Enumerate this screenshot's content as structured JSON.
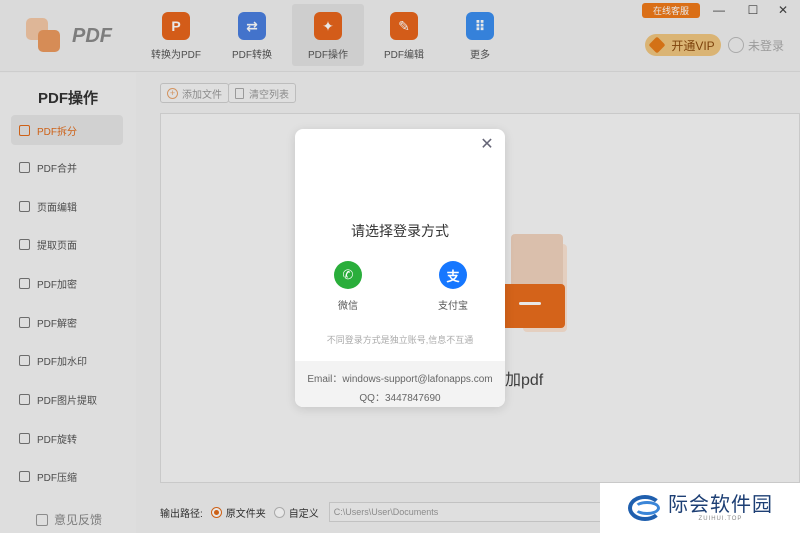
{
  "app": {
    "logo_text": "PDF"
  },
  "toolbar": {
    "tools": [
      {
        "label": "转换为PDF",
        "color": "#e8661c",
        "glyph": "P"
      },
      {
        "label": "PDF转换",
        "color": "#4a7fe0",
        "glyph": "⇄"
      },
      {
        "label": "PDF操作",
        "color": "#e8661c",
        "glyph": "✦"
      },
      {
        "label": "PDF编辑",
        "color": "#e8661c",
        "glyph": "✎"
      },
      {
        "label": "更多",
        "color": "#3b8ef0",
        "glyph": "⠿"
      }
    ],
    "active_index": 2
  },
  "titlebar": {
    "service_label": "在线客服",
    "min_glyph": "—",
    "max_glyph": "☐",
    "close_glyph": "✕"
  },
  "account": {
    "vip_label": "开通VIP",
    "login_label": "未登录"
  },
  "sidebar": {
    "title": "PDF操作",
    "items": [
      {
        "label": "PDF拆分"
      },
      {
        "label": "PDF合并"
      },
      {
        "label": "页面编辑"
      },
      {
        "label": "提取页面"
      },
      {
        "label": "PDF加密"
      },
      {
        "label": "PDF解密"
      },
      {
        "label": "PDF加水印"
      },
      {
        "label": "PDF图片提取"
      },
      {
        "label": "PDF旋转"
      },
      {
        "label": "PDF压缩"
      }
    ],
    "active_index": 0,
    "feedback_label": "意见反馈"
  },
  "main": {
    "add_file_label": "添加文件",
    "clear_list_label": "清空列表",
    "drop_text": "加pdf",
    "output": {
      "label": "输出路径:",
      "option_source": "原文件夹",
      "option_custom": "自定义",
      "selected": "原文件夹",
      "path_value": "C:\\Users\\User\\Documents"
    }
  },
  "modal": {
    "close_glyph": "✕",
    "title": "请选择登录方式",
    "options": [
      {
        "label": "微信",
        "color": "#2aae3b",
        "glyph": "✆"
      },
      {
        "label": "支付宝",
        "color": "#1677ff",
        "glyph": "支"
      }
    ],
    "note": "不同登录方式是独立账号,信息不互通",
    "email_line": "Email：windows-support@lafonapps.com",
    "qq_line": "QQ：3447847690"
  },
  "watermark": {
    "main_text": "际会软件园",
    "sub_text": "ZUIHUI.TOP"
  }
}
